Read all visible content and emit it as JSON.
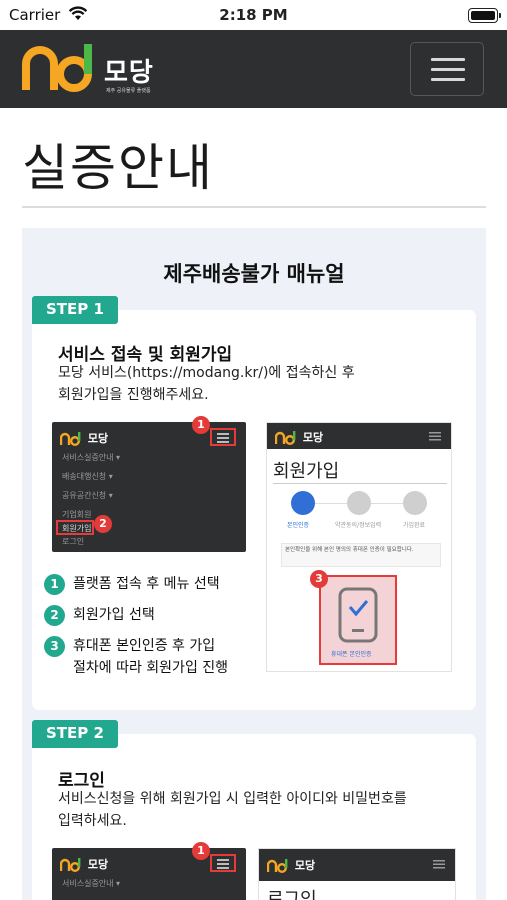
{
  "status_bar": {
    "carrier": "Carrier",
    "time": "2:18 PM"
  },
  "header": {
    "logo_text": "모당",
    "logo_subtitle": "제주 공유물류 플랫폼",
    "menu_icon": "hamburger-menu-icon"
  },
  "page": {
    "title": "실증안내"
  },
  "manual": {
    "title": "제주배송불가 매뉴얼",
    "steps": [
      {
        "badge": "STEP 1",
        "title": "서비스 접속 및 회원가입",
        "desc_line1": "모당 서비스(https://modang.kr/)에 접속하신 후",
        "desc_line2": "회원가입을 진행해주세요.",
        "left_screen": {
          "logo": "모당",
          "menu_items": [
            "서비스실증안내 ▾",
            "배송대행신청 ▾",
            "공유공간신청 ▾",
            "기업회원",
            "회원가입",
            "로그인"
          ]
        },
        "right_screen": {
          "logo": "모당",
          "title": "회원가입",
          "progress": [
            "본인인증",
            "약관동의/정보입력",
            "가입완료"
          ],
          "notice": "본인확인을 위해 본인 명의의 휴대폰 인증이 필요합니다.",
          "phone_label": "휴대폰 본인인증"
        },
        "markers": [
          "1",
          "2",
          "3"
        ],
        "bullets": [
          {
            "num": "1",
            "text": "플랫폼 접속 후 메뉴 선택"
          },
          {
            "num": "2",
            "text": "회원가입 선택"
          },
          {
            "num": "3",
            "text": "휴대폰 본인인증 후 가입",
            "text2": "절차에 따라 회원가입 진행"
          }
        ]
      },
      {
        "badge": "STEP 2",
        "title": "로그인",
        "desc_line1": "서비스신청을 위해 회원가입 시 입력한 아이디와 비밀번호를",
        "desc_line2": "입력하세요.",
        "left_screen": {
          "logo": "모당",
          "menu_items": [
            "서비스실증안내 ▾"
          ]
        },
        "right_screen": {
          "logo": "모당",
          "title": "로그인"
        },
        "markers": [
          "1"
        ]
      }
    ]
  },
  "colors": {
    "navbar": "#2e2f31",
    "accent_green": "#23a890",
    "marker_red": "#e33a3a",
    "logo_orange": "#f5a623"
  }
}
